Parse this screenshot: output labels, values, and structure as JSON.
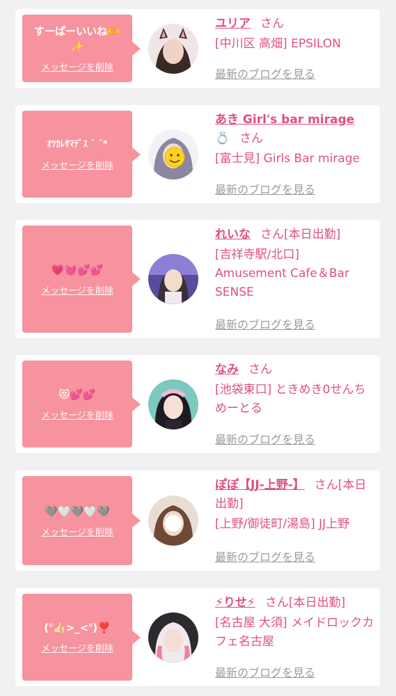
{
  "delete_label": "メッセージを削除",
  "blog_label": "最新のブログを見る",
  "san_label": "さん",
  "accent_color": "#f7939e",
  "name_color": "#e0507a",
  "items": [
    {
      "message": "すーぱーいいね🫶\n✨",
      "name": "ユリア",
      "status": "",
      "shop": "[中川区 高畑] EPSILON"
    },
    {
      "message": "ｵﾂｶﾚｻﾏﾃﾞｽ ˆ ˆ*",
      "name": "あき Girl's bar mirage",
      "name_icon": "💍",
      "status": "",
      "shop": "[富士見] Girls Bar mirage"
    },
    {
      "message": "💗💓💕💕",
      "name": "れいな",
      "status": "[本日出勤]",
      "shop": "[吉祥寺駅/北口] Amusement Cafe＆Bar SENSE"
    },
    {
      "message": "😻💕💕",
      "name": "なみ",
      "status": "",
      "shop": "[池袋東口] ときめき0せんちめーとる"
    },
    {
      "message": "🩶🤍🩶🤍🩶",
      "name": "ぽぽ【JJ-上野-】",
      "status": "[本日出勤]",
      "shop": "[上野/御徒町/湯島] JJ上野"
    },
    {
      "message": "(ᐡ👍🏻>_<ᐡ)❣️",
      "name": "⚡りせ⚡",
      "status": "[本日出勤]",
      "shop": "[名古屋 大須] メイドロックカフェ名古屋"
    }
  ]
}
